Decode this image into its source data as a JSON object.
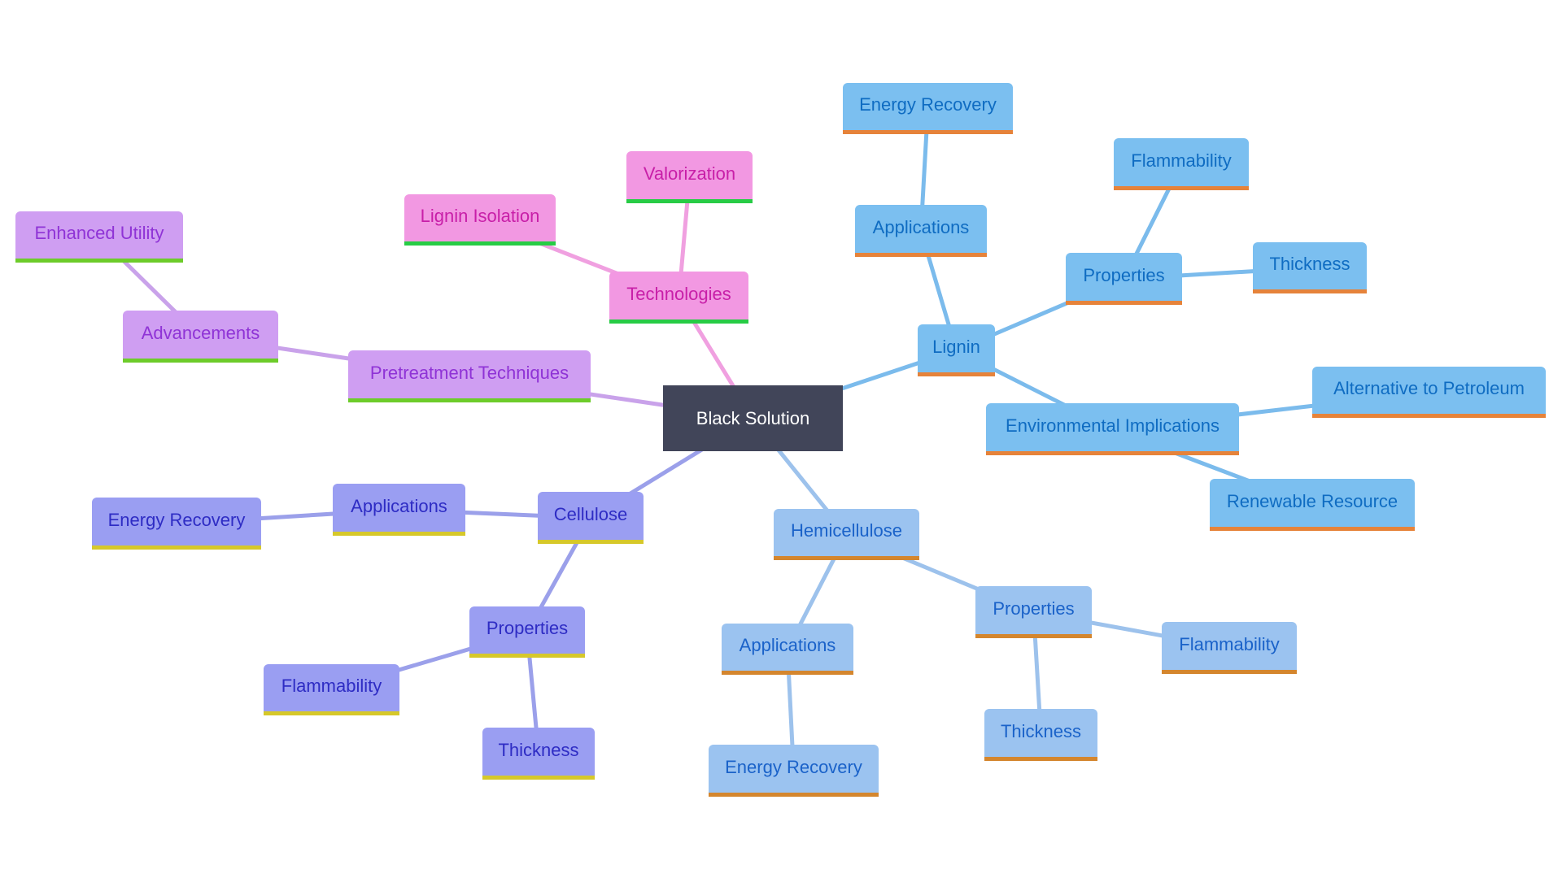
{
  "diagram": {
    "type": "mindmap",
    "root": {
      "id": "root",
      "label": "Black Solution"
    },
    "themes": {
      "root": {
        "fill": "#414559",
        "text": "#ffffff",
        "border": "#414559",
        "edge": "#414559"
      },
      "pink": {
        "fill": "#f298e2",
        "text": "#c81fa8",
        "border": "#27cc45",
        "edge": "#f0a0e0"
      },
      "violet": {
        "fill": "#cf9ef2",
        "text": "#8f33d6",
        "border": "#6dcc2a",
        "edge": "#c9a2ea"
      },
      "sky": {
        "fill": "#7bbff0",
        "text": "#0f6cc2",
        "border": "#e6833a",
        "edge": "#7bbbec"
      },
      "lightblue": {
        "fill": "#9bc3f0",
        "text": "#1a62c9",
        "border": "#d4862e",
        "edge": "#9dc2ec"
      },
      "indigo": {
        "fill": "#9a9ef2",
        "text": "#2e2cc4",
        "border": "#d6c82a",
        "edge": "#9ba0ea"
      }
    },
    "nodes": [
      {
        "id": "root",
        "label": "Black Solution",
        "theme": "root",
        "parent": null
      },
      {
        "id": "tech",
        "label": "Technologies",
        "theme": "pink",
        "parent": "root"
      },
      {
        "id": "valor",
        "label": "Valorization",
        "theme": "pink",
        "parent": "tech"
      },
      {
        "id": "ligiso",
        "label": "Lignin Isolation",
        "theme": "pink",
        "parent": "tech"
      },
      {
        "id": "pretreat",
        "label": "Pretreatment Techniques",
        "theme": "violet",
        "parent": "root"
      },
      {
        "id": "adv",
        "label": "Advancements",
        "theme": "violet",
        "parent": "pretreat"
      },
      {
        "id": "enh",
        "label": "Enhanced Utility",
        "theme": "violet",
        "parent": "adv"
      },
      {
        "id": "lignin",
        "label": "Lignin",
        "theme": "sky",
        "parent": "root"
      },
      {
        "id": "l_app",
        "label": "Applications",
        "theme": "sky",
        "parent": "lignin"
      },
      {
        "id": "l_er",
        "label": "Energy Recovery",
        "theme": "sky",
        "parent": "l_app"
      },
      {
        "id": "l_prop",
        "label": "Properties",
        "theme": "sky",
        "parent": "lignin"
      },
      {
        "id": "l_flam",
        "label": "Flammability",
        "theme": "sky",
        "parent": "l_prop"
      },
      {
        "id": "l_thick",
        "label": "Thickness",
        "theme": "sky",
        "parent": "l_prop"
      },
      {
        "id": "l_env",
        "label": "Environmental Implications",
        "theme": "sky",
        "parent": "lignin"
      },
      {
        "id": "l_alt",
        "label": "Alternative to Petroleum",
        "theme": "sky",
        "parent": "l_env"
      },
      {
        "id": "l_ren",
        "label": "Renewable Resource",
        "theme": "sky",
        "parent": "l_env"
      },
      {
        "id": "hemi",
        "label": "Hemicellulose",
        "theme": "lightblue",
        "parent": "root"
      },
      {
        "id": "h_app",
        "label": "Applications",
        "theme": "lightblue",
        "parent": "hemi"
      },
      {
        "id": "h_er",
        "label": "Energy Recovery",
        "theme": "lightblue",
        "parent": "h_app"
      },
      {
        "id": "h_prop",
        "label": "Properties",
        "theme": "lightblue",
        "parent": "hemi"
      },
      {
        "id": "h_flam",
        "label": "Flammability",
        "theme": "lightblue",
        "parent": "h_prop"
      },
      {
        "id": "h_thick",
        "label": "Thickness",
        "theme": "lightblue",
        "parent": "h_prop"
      },
      {
        "id": "cell",
        "label": "Cellulose",
        "theme": "indigo",
        "parent": "root"
      },
      {
        "id": "c_app",
        "label": "Applications",
        "theme": "indigo",
        "parent": "cell"
      },
      {
        "id": "c_er",
        "label": "Energy Recovery",
        "theme": "indigo",
        "parent": "c_app"
      },
      {
        "id": "c_prop",
        "label": "Properties",
        "theme": "indigo",
        "parent": "cell"
      },
      {
        "id": "c_flam",
        "label": "Flammability",
        "theme": "indigo",
        "parent": "c_prop"
      },
      {
        "id": "c_thick",
        "label": "Thickness",
        "theme": "indigo",
        "parent": "c_prop"
      }
    ]
  }
}
